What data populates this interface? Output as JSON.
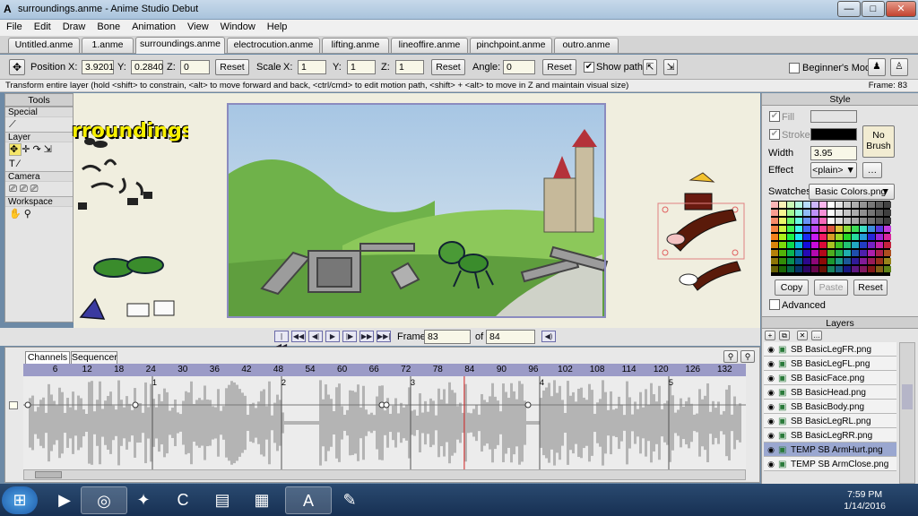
{
  "window": {
    "title": "surroundings.anme - Anime Studio Debut",
    "app_icon": "A",
    "min": "—",
    "max": "□",
    "close": "✕"
  },
  "menu": [
    "File",
    "Edit",
    "Draw",
    "Bone",
    "Animation",
    "View",
    "Window",
    "Help"
  ],
  "doc_tabs": [
    "Untitled.anme",
    "1.anme",
    "surroundings.anme",
    "electrocution.anme",
    "lifting.anme",
    "lineoffire.anme",
    "pinchpoint.anme",
    "outro.anme"
  ],
  "tool_options": {
    "position_label": "Position",
    "x_label": "X:",
    "x_value": "3.9201",
    "y_label": "Y:",
    "y_value": "0.2840",
    "z_label": "Z:",
    "z_value": "0",
    "reset": "Reset",
    "scale_label": "Scale",
    "sx": "1",
    "sy": "1",
    "sz": "1",
    "angle_label": "Angle:",
    "angle_value": "0",
    "show_path": "Show path",
    "show_path_checked": "✔",
    "beginners_mode": "Beginner's Mode"
  },
  "hint": {
    "text": "Transform entire layer (hold <shift> to constrain, <alt> to move forward and back, <ctrl/cmd> to edit motion path, <shift> + <alt> to move in Z and maintain visual size)",
    "frame": "Frame: 83"
  },
  "tools": {
    "title": "Tools",
    "sections": [
      "Special",
      "Layer",
      "Camera",
      "Workspace"
    ]
  },
  "canvas": {
    "overlay_text": "rroundings"
  },
  "playback": {
    "frame_label": "Frame",
    "frame_value": "83",
    "of_label": "of",
    "total": "84"
  },
  "timeline": {
    "tabs": [
      "Channels",
      "Sequencer"
    ],
    "ruler": [
      "6",
      "12",
      "18",
      "24",
      "30",
      "36",
      "42",
      "48",
      "54",
      "60",
      "66",
      "72",
      "78",
      "84",
      "90",
      "96",
      "102",
      "108",
      "114",
      "120",
      "126",
      "132"
    ],
    "markers": [
      "1",
      "2",
      "3",
      "4",
      "5"
    ]
  },
  "style": {
    "title": "Style",
    "fill": "Fill",
    "stroke": "Stroke",
    "width_label": "Width",
    "width_value": "3.95",
    "no_brush": "No Brush",
    "effect_label": "Effect",
    "effect_value": "<plain> ▼",
    "swatches_label": "Swatches",
    "swatches_value": "Basic Colors.png",
    "copy": "Copy",
    "paste": "Paste",
    "reset": "Reset",
    "advanced": "Advanced",
    "stroke_color": "#000000",
    "fill_color": "#ffffff"
  },
  "layers": {
    "title": "Layers",
    "items": [
      "SB BasicLegFR.png",
      "SB BasicLegFL.png",
      "SB BasicFace.png",
      "SB BasicHead.png",
      "SB BasicBody.png",
      "SB BasicLegRL.png",
      "SB BasicLegRR.png",
      "TEMP SB ArmHurt.png",
      "TEMP SB ArmClose.png"
    ],
    "selected_index": 7
  },
  "taskbar": {
    "time": "7:59 PM",
    "date": "1/14/2016"
  }
}
